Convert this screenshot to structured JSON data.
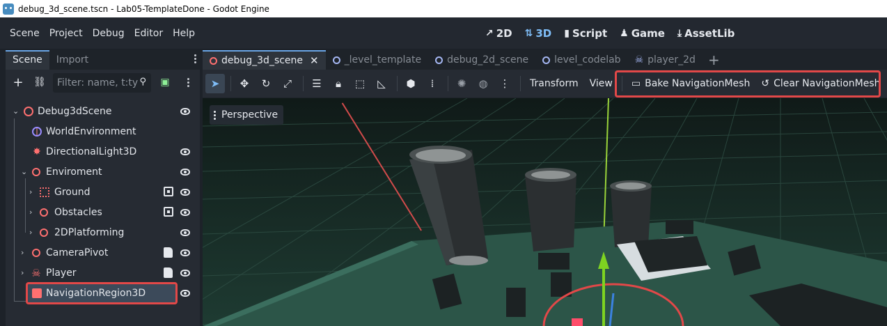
{
  "window": {
    "title": "debug_3d_scene.tscn - Lab05-TemplateDone - Godot Engine"
  },
  "menu": [
    "Scene",
    "Project",
    "Debug",
    "Editor",
    "Help"
  ],
  "workspaces": [
    {
      "label": "2D",
      "icon": "2d-icon"
    },
    {
      "label": "3D",
      "icon": "3d-icon",
      "active": true
    },
    {
      "label": "Script",
      "icon": "script-icon"
    },
    {
      "label": "Game",
      "icon": "game-icon"
    },
    {
      "label": "AssetLib",
      "icon": "assetlib-icon"
    }
  ],
  "dock": {
    "tabs": [
      "Scene",
      "Import"
    ],
    "filter_placeholder": "Filter: name, t:ty"
  },
  "tree": [
    {
      "label": "Debug3dScene",
      "icon": "node3d-icon"
    },
    {
      "label": "WorldEnvironment",
      "icon": "world-environment-icon"
    },
    {
      "label": "DirectionalLight3D",
      "icon": "directional-light-icon"
    },
    {
      "label": "Enviroment",
      "icon": "node3d-icon"
    },
    {
      "label": "Ground",
      "icon": "static-body-icon"
    },
    {
      "label": "Obstacles",
      "icon": "node3d-icon"
    },
    {
      "label": "2DPlatforming",
      "icon": "node3d-icon"
    },
    {
      "label": "CameraPivot",
      "icon": "node3d-icon"
    },
    {
      "label": "Player",
      "icon": "character-icon"
    },
    {
      "label": "NavigationRegion3D",
      "icon": "navigation-region-icon",
      "selected": true
    }
  ],
  "editor_tabs": [
    {
      "label": "debug_3d_scene",
      "active": true,
      "color": "#ff7070"
    },
    {
      "label": "_level_template",
      "color": "#a5b7f3"
    },
    {
      "label": "debug_2d_scene",
      "color": "#a5b7f3"
    },
    {
      "label": "level_codelab",
      "color": "#a5b7f3"
    },
    {
      "label": "player_2d",
      "color": "#a5b7f3"
    }
  ],
  "toolbar": {
    "transform_label": "Transform",
    "view_label": "View",
    "bake_label": "Bake NavigationMesh",
    "clear_label": "Clear NavigationMesh"
  },
  "viewport": {
    "mode_label": "Perspective"
  },
  "colors": {
    "accent": "#7fbdf7",
    "highlight": "#e24848",
    "node3d": "#ff7070"
  }
}
